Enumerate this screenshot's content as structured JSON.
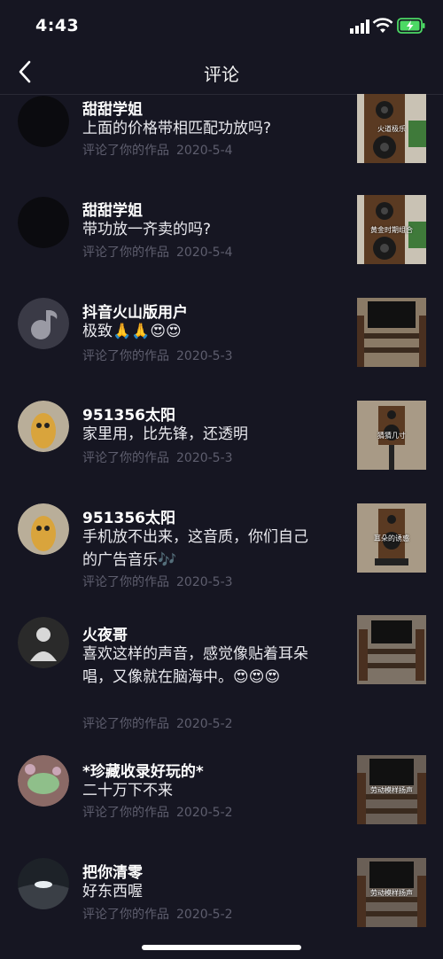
{
  "status": {
    "time": "4:43"
  },
  "header": {
    "title": "评论"
  },
  "comments": [
    {
      "name": "甜甜学姐",
      "text": "上面的价格带相匹配功放吗?",
      "action": "评论了你的作品",
      "date": "2020-5-4",
      "thumb_caption": "火道极乐"
    },
    {
      "name": "甜甜学姐",
      "text": "带功放一齐卖的吗?",
      "action": "评论了你的作品",
      "date": "2020-5-4",
      "thumb_caption": "黄金时期组合"
    },
    {
      "name": "抖音火山版用户",
      "text": "极致🙏🙏😍😍",
      "action": "评论了你的作品",
      "date": "2020-5-3",
      "thumb_caption": ""
    },
    {
      "name": "951356太阳",
      "text": "家里用，比先锋，还透明",
      "action": "评论了你的作品",
      "date": "2020-5-3",
      "thumb_caption": "猜猜几寸"
    },
    {
      "name": "951356太阳",
      "text": "手机放不出来，这音质，你们自己的广告音乐🎶",
      "action": "评论了你的作品",
      "date": "2020-5-3",
      "thumb_caption": "耳朵的诱惑"
    },
    {
      "name": "火夜哥",
      "text": "喜欢这样的声音，感觉像贴着耳朵唱，又像就在脑海中。😍😍😍",
      "action": "评论了你的作品",
      "date": "2020-5-2",
      "thumb_caption": ""
    },
    {
      "name": "*珍藏收录好玩的*",
      "text": "二十万下不来",
      "action": "评论了你的作品",
      "date": "2020-5-2",
      "thumb_caption": "劳动模样扬声"
    },
    {
      "name": "把你清零",
      "text": "好东西喔",
      "action": "评论了你的作品",
      "date": "2020-5-2",
      "thumb_caption": "劳动模样扬声"
    }
  ],
  "icons": {
    "back": "chevron-left-icon",
    "signal": "cellular-signal-icon",
    "wifi": "wifi-icon",
    "battery": "battery-charging-icon"
  },
  "colors": {
    "background": "#161622",
    "meta_text": "#5e5e6e",
    "battery": "#4cd964"
  }
}
